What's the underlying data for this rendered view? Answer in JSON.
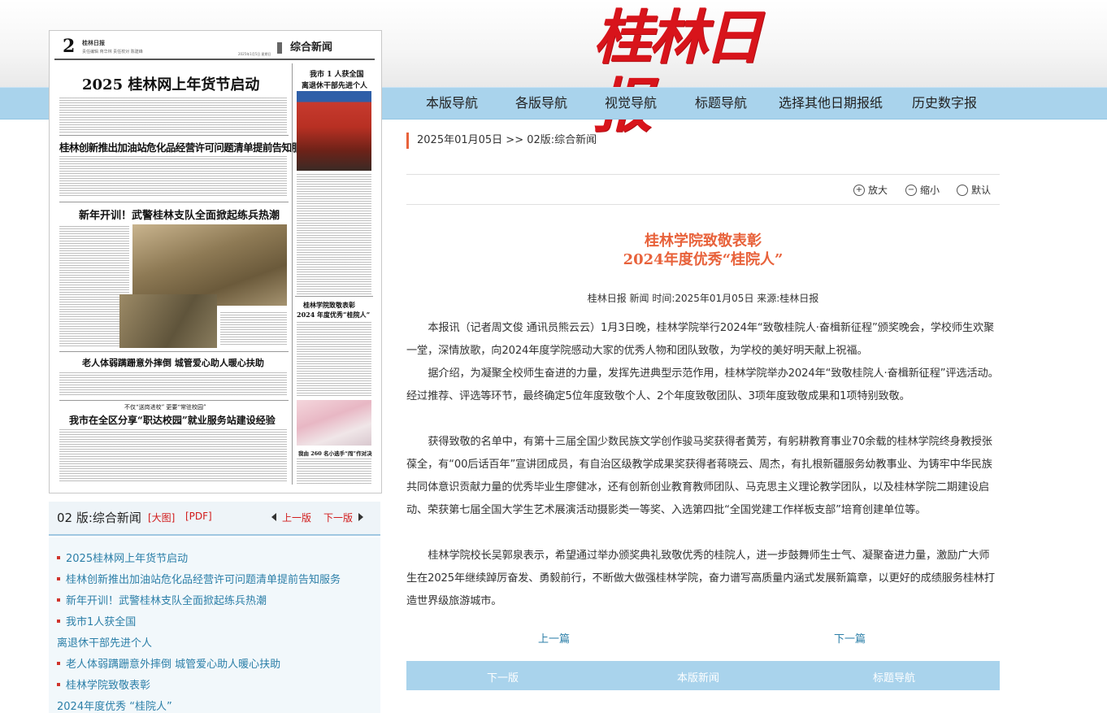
{
  "header": {
    "logo_text": "桂林日报"
  },
  "nav": [
    "本版导航",
    "各版导航",
    "视觉导航",
    "标题导航",
    "选择其他日期报纸",
    "历史数字报"
  ],
  "paper_thumbnail": {
    "page_number": "2",
    "masthead": "桂林日报",
    "masthead_sub": "责任编辑 蒋华林  责任校对 陈建峰",
    "date": "2025年1月5日 星期日",
    "section": "综合新闻",
    "headlines": [
      "2025 桂林网上年货节启动",
      "桂林创新推出加油站危化品经营许可问题清单提前告知服务",
      "新年开训！武警桂林支队全面掀起练兵热潮",
      "老人体弱蹒跚意外摔倒   城管爱心助人暖心扶助",
      "我市在全区分享“职达校园”就业服务站建设经验",
      "不仅“送岗进校” 更要“常驻校园”"
    ],
    "side_headlines": [
      "我市 1 人获全国",
      "离退休干部先进个人",
      "桂林学院致敬表彰",
      "2024 年度优秀“桂院人”",
      "我由 260 名小选手“闯”作对决"
    ]
  },
  "left_bar": {
    "title": "02 版:综合新闻",
    "big_image": "[大图]",
    "pdf": "[PDF]",
    "prev": "上一版",
    "next": "下一版"
  },
  "article_list": [
    {
      "text": "2025桂林网上年货节启动",
      "bullet": true
    },
    {
      "text": "桂林创新推出加油站危化品经营许可问题清单提前告知服务",
      "bullet": true
    },
    {
      "text": "新年开训！武警桂林支队全面掀起练兵热潮",
      "bullet": true
    },
    {
      "text": "我市1人获全国",
      "bullet": true
    },
    {
      "text": "离退休干部先进个人",
      "bullet": false
    },
    {
      "text": "老人体弱蹒跚意外摔倒 城管爱心助人暖心扶助",
      "bullet": true
    },
    {
      "text": "桂林学院致敬表彰",
      "bullet": true
    },
    {
      "text": "2024年度优秀 “桂院人”",
      "bullet": false
    }
  ],
  "breadcrumb": "2025年01月05日 >> 02版:综合新闻",
  "tools": {
    "zoom_in": "放大",
    "zoom_out": "缩小",
    "default": "默认"
  },
  "article": {
    "title_line1": "桂林学院致敬表彰",
    "title_line2": "2024年度优秀“桂院人”",
    "meta": "桂林日报 新闻    时间:2025年01月05日    来源:桂林日报",
    "paragraphs": [
      "本报讯（记者周文俊 通讯员熊云云）1月3日晚，桂林学院举行2024年“致敬桂院人·奋楫新征程”颁奖晚会，学校师生欢聚一堂，深情放歌，向2024年度学院感动大家的优秀人物和团队致敬，为学校的美好明天献上祝福。",
      "据介绍，为凝聚全校师生奋进的力量，发挥先进典型示范作用，桂林学院举办2024年“致敬桂院人·奋楫新征程”评选活动。经过推荐、评选等环节，最终确定5位年度致敬个人、2个年度致敬团队、3项年度致敬成果和1项特别致敬。",
      "获得致敬的名单中，有第十三届全国少数民族文学创作骏马奖获得者黄芳，有躬耕教育事业70余载的桂林学院终身教授张葆全，有“00后话百年”宣讲团成员，有自治区级教学成果奖获得者蒋晓云、周杰，有扎根新疆服务幼教事业、为铸牢中华民族共同体意识贡献力量的优秀毕业生廖健冰，还有创新创业教育教师团队、马克思主义理论教学团队，以及桂林学院二期建设启动、荣获第七届全国大学生艺术展演活动摄影类一等奖、入选第四批“全国党建工作样板支部”培育创建单位等。",
      "桂林学院校长吴郭泉表示，希望通过举办颁奖典礼致敬优秀的桂院人，进一步鼓舞师生士气、凝聚奋进力量，激励广大师生在2025年继续踔厉奋发、勇毅前行，不断做大做强桂林学院，奋力谱写高质量内涵式发展新篇章，以更好的成绩服务桂林打造世界级旅游城市。"
    ],
    "prev": "上一篇",
    "next": "下一篇"
  },
  "bottom_bar": {
    "next_page": "下一版",
    "this_page_news": "本版新闻",
    "title_nav": "标题导航"
  },
  "colors": {
    "accent": "#e8623b",
    "nav_bg": "#a9d3ec",
    "link": "#2c7fa8",
    "logo": "#d8141b"
  }
}
